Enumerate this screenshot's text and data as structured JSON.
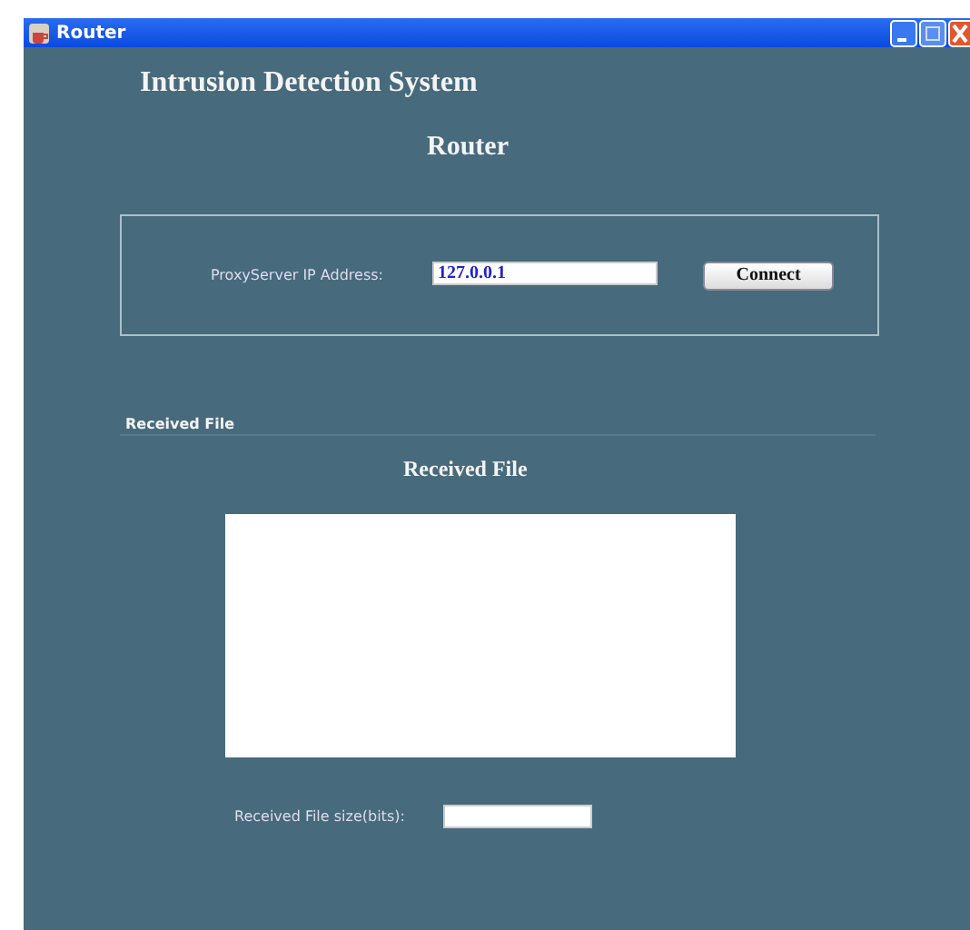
{
  "window": {
    "title": "Router"
  },
  "heading": "Intrusion Detection System",
  "subtitle": "Router",
  "connection": {
    "label": "ProxyServer IP Address:",
    "value": "127.0.0.1",
    "button": "Connect"
  },
  "received": {
    "section_label": "Received File",
    "title": "Received File",
    "size_label": "Received File size(bits):"
  }
}
